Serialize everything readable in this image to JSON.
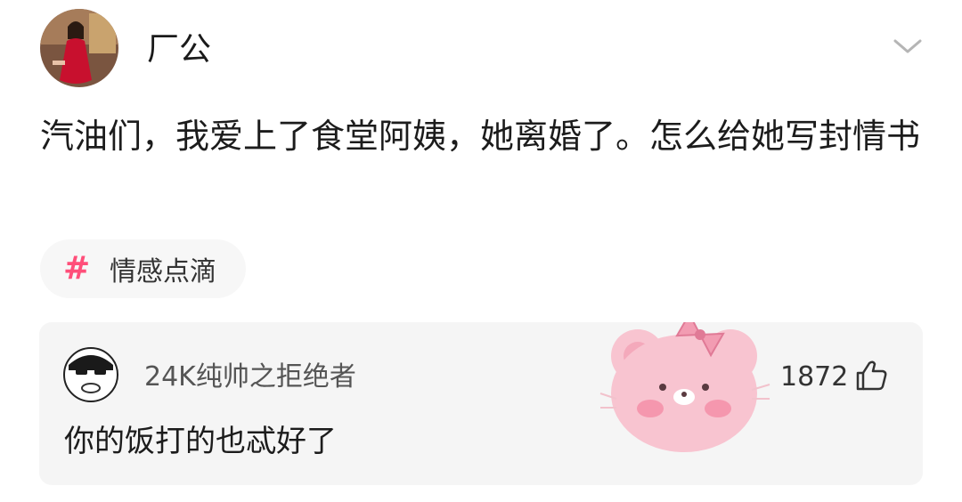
{
  "post": {
    "author_name": "厂公",
    "text": "汽油们，我爱上了食堂阿姨，她离婚了。怎么给她写封情书",
    "topic_tag": "情感点滴",
    "topic_symbol": "#"
  },
  "comment": {
    "author_name": "24K纯帅之拒绝者",
    "text": "你的饭打的也忒好了",
    "like_count": "1872"
  },
  "icons": {
    "menu": "chevron-down-icon",
    "like": "thumbs-up-icon",
    "sticker": "pink-bear-sticker"
  },
  "colors": {
    "tag_symbol": "#ff4f7a",
    "card_background": "#f5f5f5",
    "sticker_pink": "#f8c4d0"
  }
}
